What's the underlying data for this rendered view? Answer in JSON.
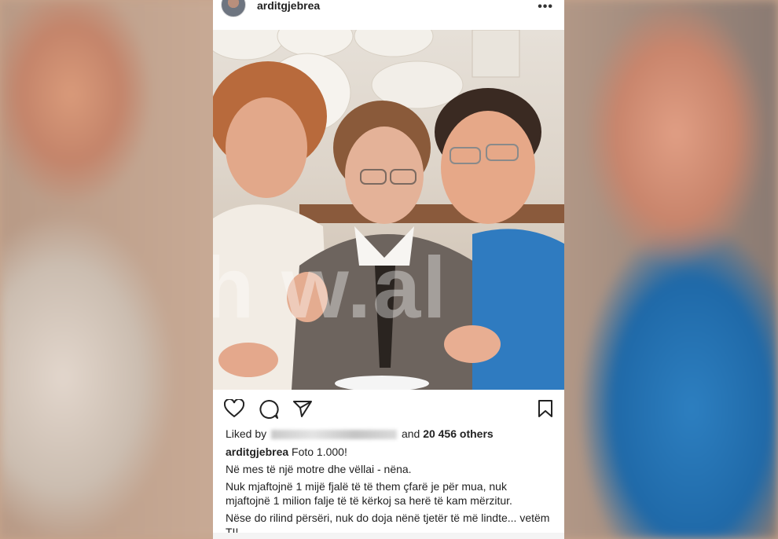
{
  "post": {
    "username": "arditgjebrea",
    "more_icon": "more-horizontal-icon",
    "watermark": "Sh w.al",
    "actions": {
      "like_icon": "heart-icon",
      "comment_icon": "comment-icon",
      "share_icon": "send-icon",
      "save_icon": "bookmark-icon"
    },
    "likes": {
      "prefix": "Liked by",
      "middle": "and",
      "count": "20 456 others"
    },
    "caption": {
      "user": "arditgjebrea",
      "first_line": "Foto 1.000!",
      "lines": [
        "Në mes të një motre dhe vëllai - nëna.",
        "Nuk mjaftojnë 1 mijë fjalë të të them çfarë je për mua, nuk mjaftojnë 1 milion falje të të kërkoj sa herë të kam mërzitur.",
        "Nëse do rilind përsëri, nuk do doja nënë tjetër të më lindte... vetëm TI!"
      ]
    }
  }
}
